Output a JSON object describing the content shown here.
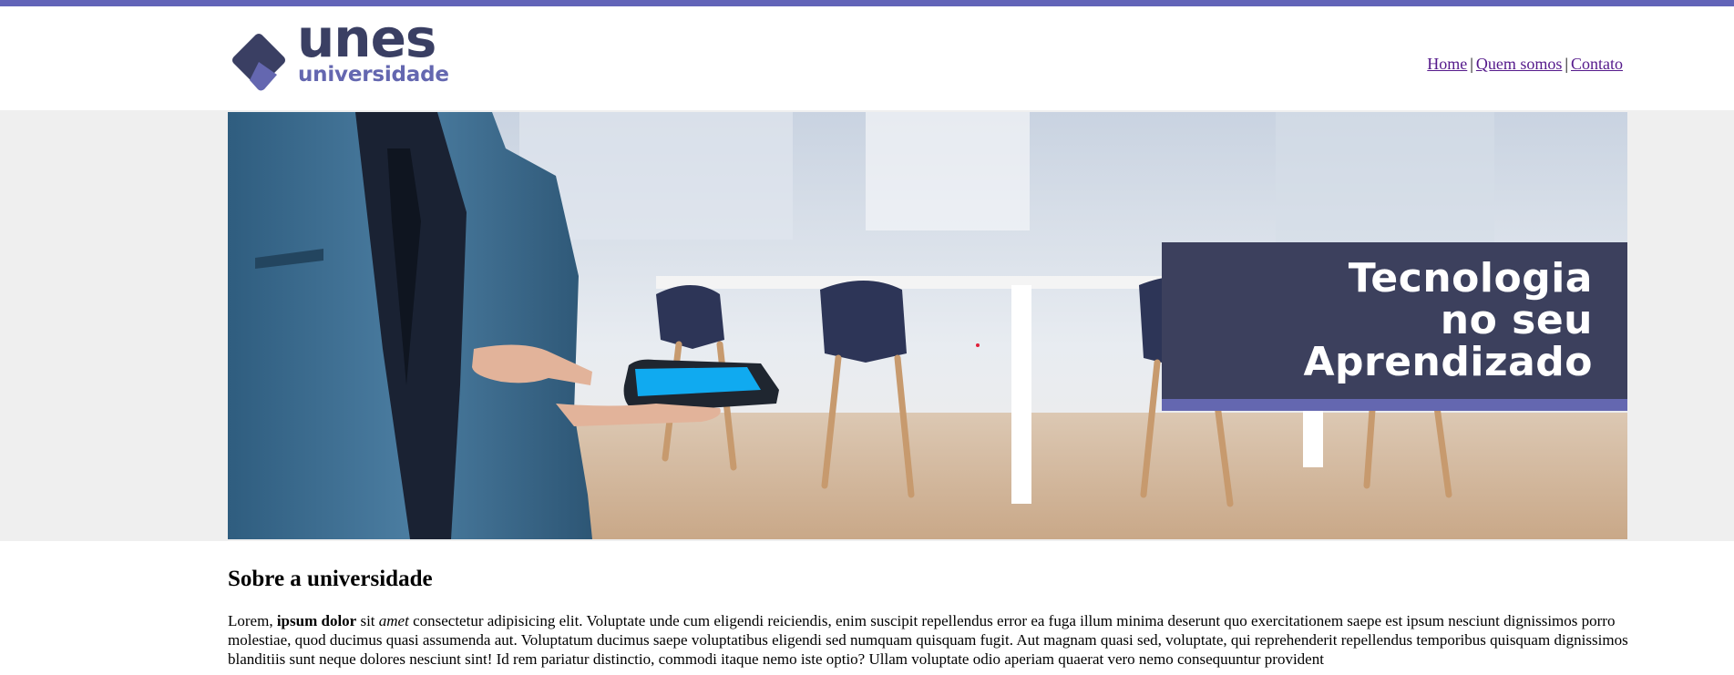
{
  "brand": {
    "name": "unes",
    "tagline": "universidade",
    "colors": {
      "primary_dark": "#3a3f63",
      "primary_light": "#6467b0",
      "top_bar": "#6264b8"
    }
  },
  "nav": {
    "items": [
      {
        "label": "Home",
        "icon": ""
      },
      {
        "label": "Quem somos",
        "icon": ""
      },
      {
        "label": "Contato",
        "icon": ""
      }
    ],
    "separator": "|"
  },
  "banner": {
    "headline": [
      "Tecnologia",
      "no seu",
      "Aprendizado"
    ]
  },
  "section": {
    "title": "Sobre a universidade",
    "paragraph": {
      "lead": "Lorem, ",
      "bold": "ipsum dolor",
      "mid": " sit ",
      "italic": "amet",
      "rest": " consectetur adipisicing elit. Voluptate unde cum eligendi reiciendis, enim suscipit repellendus error ea fuga illum minima deserunt quo exercitationem saepe est ipsum nesciunt dignissimos porro molestiae, quod ducimus quasi assumenda aut. Voluptatum ducimus saepe voluptatibus eligendi sed numquam quisquam fugit. Aut magnam quasi sed, voluptate, qui reprehenderit repellendus temporibus quisquam dignissimos blanditiis sunt neque dolores nesciunt sint! Id rem pariatur distinctio, commodi itaque nemo iste optio? Ullam voluptate odio aperiam quaerat vero nemo consequuntur provident"
    }
  }
}
